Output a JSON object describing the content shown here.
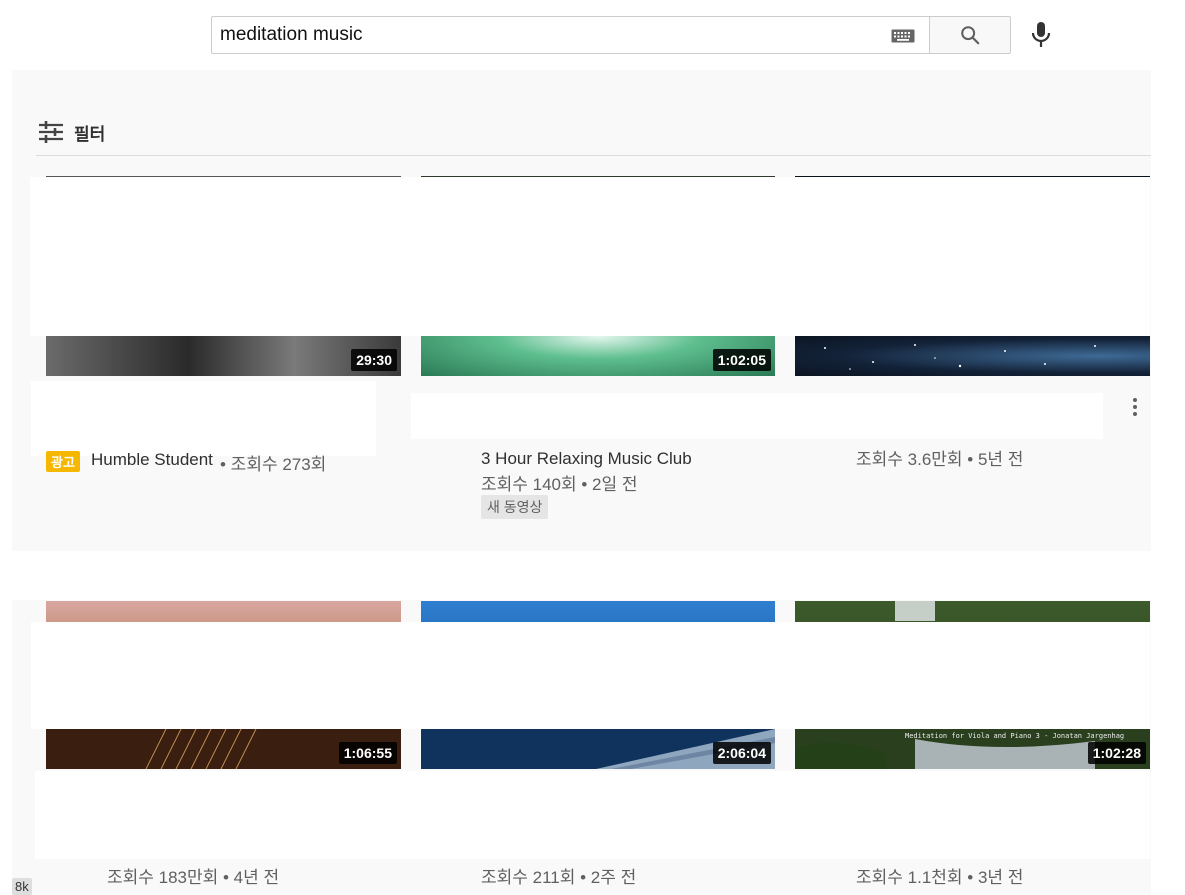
{
  "search": {
    "query": "meditation music",
    "keyboard_icon": "keyboard-icon",
    "search_icon": "search-icon",
    "mic_icon": "mic-icon"
  },
  "filter": {
    "label": "필터",
    "icon": "tune-icon"
  },
  "videos": [
    {
      "duration": "29:30",
      "ad_badge": "광고",
      "channel": "Humble Student",
      "views_line": "• 조회수 273회"
    },
    {
      "duration": "1:02:05",
      "channel": "3 Hour Relaxing Music Club",
      "views_line": "조회수 140회 • 2일 전",
      "badge": "새 동영상"
    },
    {
      "duration": "",
      "views_line": "조회수 3.6만회 • 5년 전"
    },
    {
      "duration": "1:06:55",
      "views_line": "조회수 183만회 • 4년 전"
    },
    {
      "duration": "2:06:04",
      "views_line": "조회수 211회 • 2주 전"
    },
    {
      "duration": "1:02:28",
      "views_line": "조회수 1.1천회 • 3년 전",
      "thumb_caption": "Meditation for Viola and Piano 3 - Jonatan Jargenhag"
    }
  ],
  "corner_tag": "8k",
  "colors": {
    "results_bg": "#f9f9f9",
    "ad_badge": "#f5b700",
    "duration_bg": "#000000"
  }
}
